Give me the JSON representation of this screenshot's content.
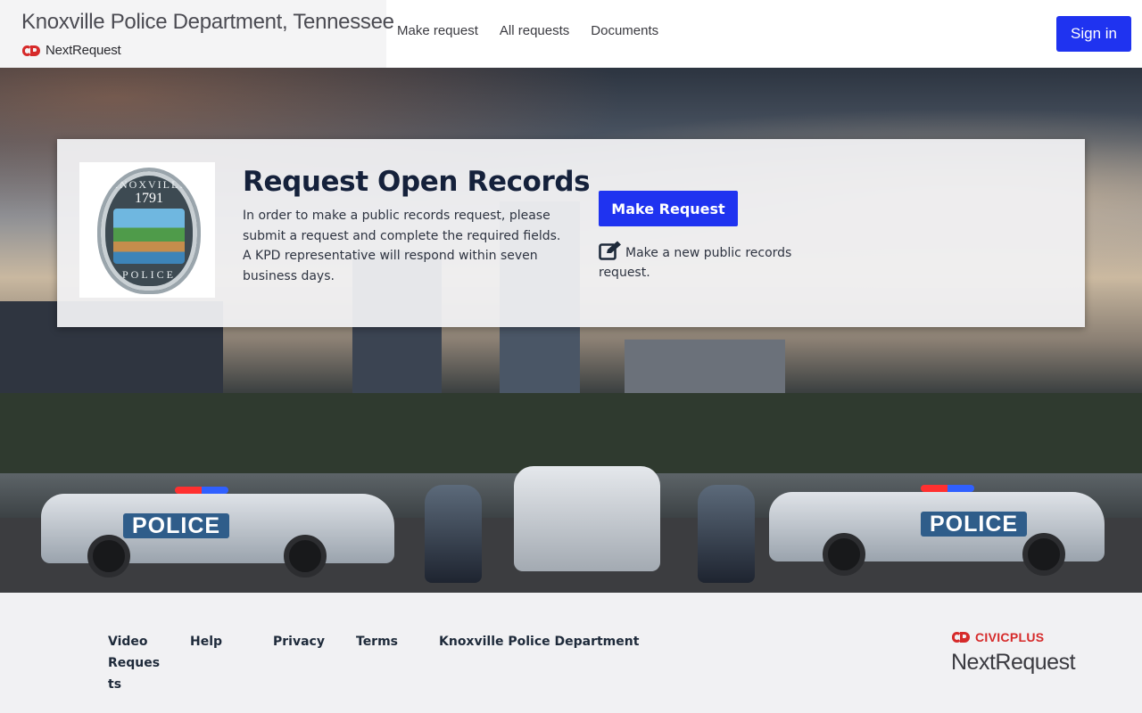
{
  "header": {
    "agency_name": "Knoxville Police Department, Tennessee",
    "logo_text": "NextRequest",
    "nav": [
      {
        "label": "Make request"
      },
      {
        "label": "All requests"
      },
      {
        "label": "Documents"
      }
    ],
    "signin_label": "Sign in"
  },
  "seal": {
    "top_text": "KNOXVILLE",
    "year": "1791",
    "bottom_text": "POLICE"
  },
  "hero": {
    "car_decal": "POLICE"
  },
  "card": {
    "title": "Request Open Records",
    "description": "In order to make a public records request, please submit a request and complete the required fields. A KPD representative will respond within seven business days.",
    "button_label": "Make Request",
    "help_text": "Make a new public records request."
  },
  "footer": {
    "links": [
      {
        "label": "Video Requests"
      },
      {
        "label": "Help"
      },
      {
        "label": "Privacy"
      },
      {
        "label": "Terms"
      },
      {
        "label": "Knoxville Police Department"
      }
    ],
    "brand_top": "CIVICPLUS",
    "brand_bottom": "NextRequest"
  },
  "colors": {
    "primary_button": "#1f33f0",
    "brand_red": "#d62a2a",
    "title_navy": "#15213b"
  },
  "icons": [
    "civicplus-logo-icon",
    "edit-icon"
  ]
}
